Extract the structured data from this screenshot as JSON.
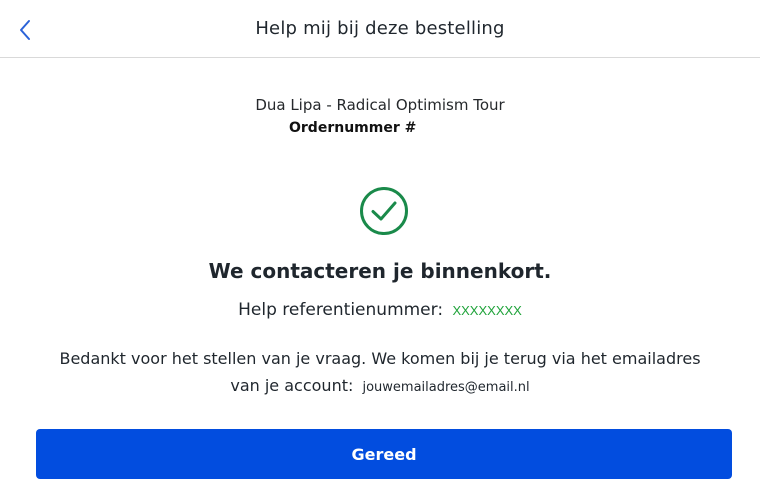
{
  "header": {
    "title": "Help mij bij deze bestelling",
    "back_icon": "chevron-left-icon"
  },
  "order": {
    "event_name": "Dua Lipa - Radical Optimism Tour",
    "order_number_label": "Ordernummer #"
  },
  "confirmation": {
    "icon": "check-circle-icon",
    "headline": "We contacteren je binnenkort.",
    "reference_label": "Help referentienummer:",
    "reference_value": "XXXXXXXX",
    "thanks_line1": "Bedankt voor het stellen van je vraag. We komen bij je terug via het emailadres",
    "thanks_line2": "van je account:",
    "email": "jouwemailadres@email.nl"
  },
  "actions": {
    "done_label": "Gereed"
  },
  "colors": {
    "accent": "#024ddf",
    "success": "#1a8a4a",
    "reference": "#1fa33a",
    "back_icon": "#2a62d8"
  }
}
